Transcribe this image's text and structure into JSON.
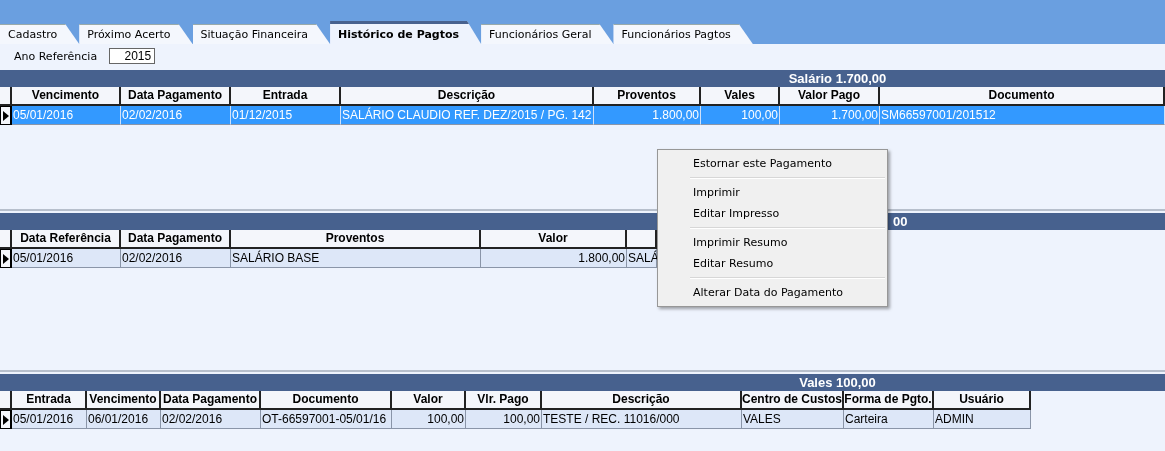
{
  "tabs": [
    {
      "label": "Cadastro",
      "selected": false
    },
    {
      "label": "Próximo Acerto",
      "selected": false
    },
    {
      "label": "Situação Financeira",
      "selected": false
    },
    {
      "label": "Histórico de Pagtos",
      "selected": true
    },
    {
      "label": "Funcionários Geral",
      "selected": false
    },
    {
      "label": "Funcionários Pagtos",
      "selected": false
    }
  ],
  "year_filter": {
    "label": "Ano Referência",
    "value": "2015"
  },
  "panels": [
    {
      "title": "Salário 1.700,00",
      "columns": [
        {
          "label": "Vencimento"
        },
        {
          "label": "Data Pagamento"
        },
        {
          "label": "Entrada"
        },
        {
          "label": "Descrição"
        },
        {
          "label": "Proventos"
        },
        {
          "label": "Vales"
        },
        {
          "label": "Valor Pago"
        },
        {
          "label": "Documento"
        }
      ],
      "rows": [
        {
          "selected": true,
          "cells": [
            "05/01/2016",
            "02/02/2016",
            "01/12/2015",
            "SALÁRIO CLAUDIO REF. DEZ/2015 / PG. 142",
            "1.800,00",
            "100,00",
            "1.700,00",
            "SM66597001/201512"
          ]
        }
      ]
    },
    {
      "title": "00",
      "columns": [
        {
          "label": "Data Referência"
        },
        {
          "label": "Data Pagamento"
        },
        {
          "label": "Proventos"
        },
        {
          "label": "Valor"
        },
        {}
      ],
      "rows": [
        {
          "selected": false,
          "cells": [
            "05/01/2016",
            "02/02/2016",
            "SALÁRIO BASE",
            "1.800,00",
            "SALÁ"
          ]
        }
      ]
    },
    {
      "title": "Vales 100,00",
      "columns": [
        {
          "label": "Entrada"
        },
        {
          "label": "Vencimento"
        },
        {
          "label": "Data Pagamento"
        },
        {
          "label": "Documento"
        },
        {
          "label": "Valor"
        },
        {
          "label": "Vlr. Pago"
        },
        {
          "label": "Descrição"
        },
        {
          "label": "Centro de Custos"
        },
        {
          "label": "Forma de Pgto."
        },
        {
          "label": "Usuário"
        }
      ],
      "rows": [
        {
          "selected": false,
          "cells": [
            "05/01/2016",
            "06/01/2016",
            "02/02/2016",
            "OT-66597001-05/01/16",
            "100,00",
            "100,00",
            "TESTE / REC. 11016/000",
            "VALES",
            "Carteira",
            "ADMIN"
          ]
        }
      ]
    }
  ],
  "context_menu": [
    {
      "kind": "item",
      "label": "Estornar este Pagamento"
    },
    {
      "kind": "separator"
    },
    {
      "kind": "item",
      "label": "Imprimir"
    },
    {
      "kind": "item",
      "label": "Editar Impresso"
    },
    {
      "kind": "separator"
    },
    {
      "kind": "item",
      "label": "Imprimir Resumo"
    },
    {
      "kind": "item",
      "label": "Editar Resumo"
    },
    {
      "kind": "separator"
    },
    {
      "kind": "item",
      "label": "Alterar Data do Pagamento"
    }
  ]
}
